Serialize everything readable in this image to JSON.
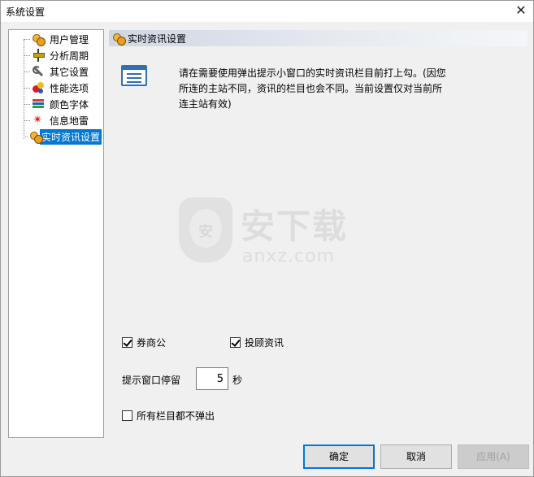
{
  "window": {
    "title": "系统设置",
    "close_glyph": "✕"
  },
  "tree": {
    "items": [
      {
        "label": "用户管理",
        "icon": "people-icon",
        "selected": false
      },
      {
        "label": "分析周期",
        "icon": "cycle-icon",
        "selected": false
      },
      {
        "label": "其它设置",
        "icon": "wrench-icon",
        "selected": false
      },
      {
        "label": "性能选项",
        "icon": "performance-icon",
        "selected": false
      },
      {
        "label": "颜色字体",
        "icon": "color-font-icon",
        "selected": false
      },
      {
        "label": "信息地雷",
        "icon": "info-mine-icon",
        "selected": false
      },
      {
        "label": "实时资讯设置",
        "icon": "people-icon",
        "selected": true
      }
    ]
  },
  "panel": {
    "title": "实时资讯设置",
    "description": "请在需要使用弹出提示小窗口的实时资讯栏目前打上勾。(因您所连的主站不同，资讯的栏目也会不同。当前设置仅对当前所连主站有效)",
    "watermark": {
      "big": "安下载",
      "small": "anxz.com"
    },
    "checkboxes": [
      {
        "label": "券商公",
        "checked": true
      },
      {
        "label": "投顾资讯",
        "checked": true
      }
    ],
    "popup_label": "提示窗口停留",
    "popup_value": "5",
    "popup_unit": "秒",
    "no_popup": {
      "label": "所有栏目都不弹出",
      "checked": false
    }
  },
  "buttons": {
    "ok": "确定",
    "cancel": "取消",
    "apply": "应用(A)"
  },
  "colors": {
    "selection": "#0078d7",
    "header_gradient_start": "#cfd7e3",
    "icon_blue": "#2f6fb6"
  }
}
